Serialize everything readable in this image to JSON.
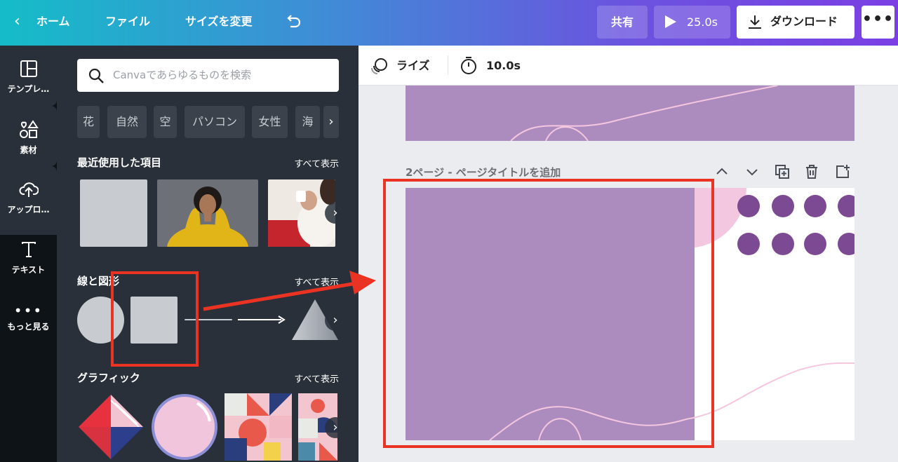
{
  "topbar": {
    "home_label": "ホーム",
    "file_label": "ファイル",
    "resize_label": "サイズを変更",
    "share_label": "共有",
    "play_duration": "25.0s",
    "download_label": "ダウンロード",
    "more_label": "•••"
  },
  "rail": {
    "items": [
      {
        "label": "テンプレ…",
        "icon": "template-icon"
      },
      {
        "label": "素材",
        "icon": "elements-icon"
      },
      {
        "label": "アップロ…",
        "icon": "upload-icon"
      },
      {
        "label": "テキスト",
        "icon": "text-icon"
      },
      {
        "label": "もっと見る",
        "icon": "more-icon"
      }
    ]
  },
  "panel": {
    "search_placeholder": "Canvaであらゆるものを検索",
    "chips": [
      "花",
      "自然",
      "空",
      "パソコン",
      "女性",
      "海"
    ],
    "recent": {
      "title": "最近使用した項目",
      "see_all": "すべて表示"
    },
    "shapes": {
      "title": "線と図形",
      "see_all": "すべて表示"
    },
    "graphics": {
      "title": "グラフィック",
      "see_all": "すべて表示"
    }
  },
  "canvas": {
    "animation_label": "ライズ",
    "duration_label": "10.0s",
    "page2_title": "2ページ - ページタイトルを追加"
  },
  "colors": {
    "accent_red": "#ea3323",
    "page_purple": "#ac8cbf",
    "dot_purple": "#7c4a92",
    "pink": "#f3c7e0",
    "panel_bg": "#293039"
  }
}
